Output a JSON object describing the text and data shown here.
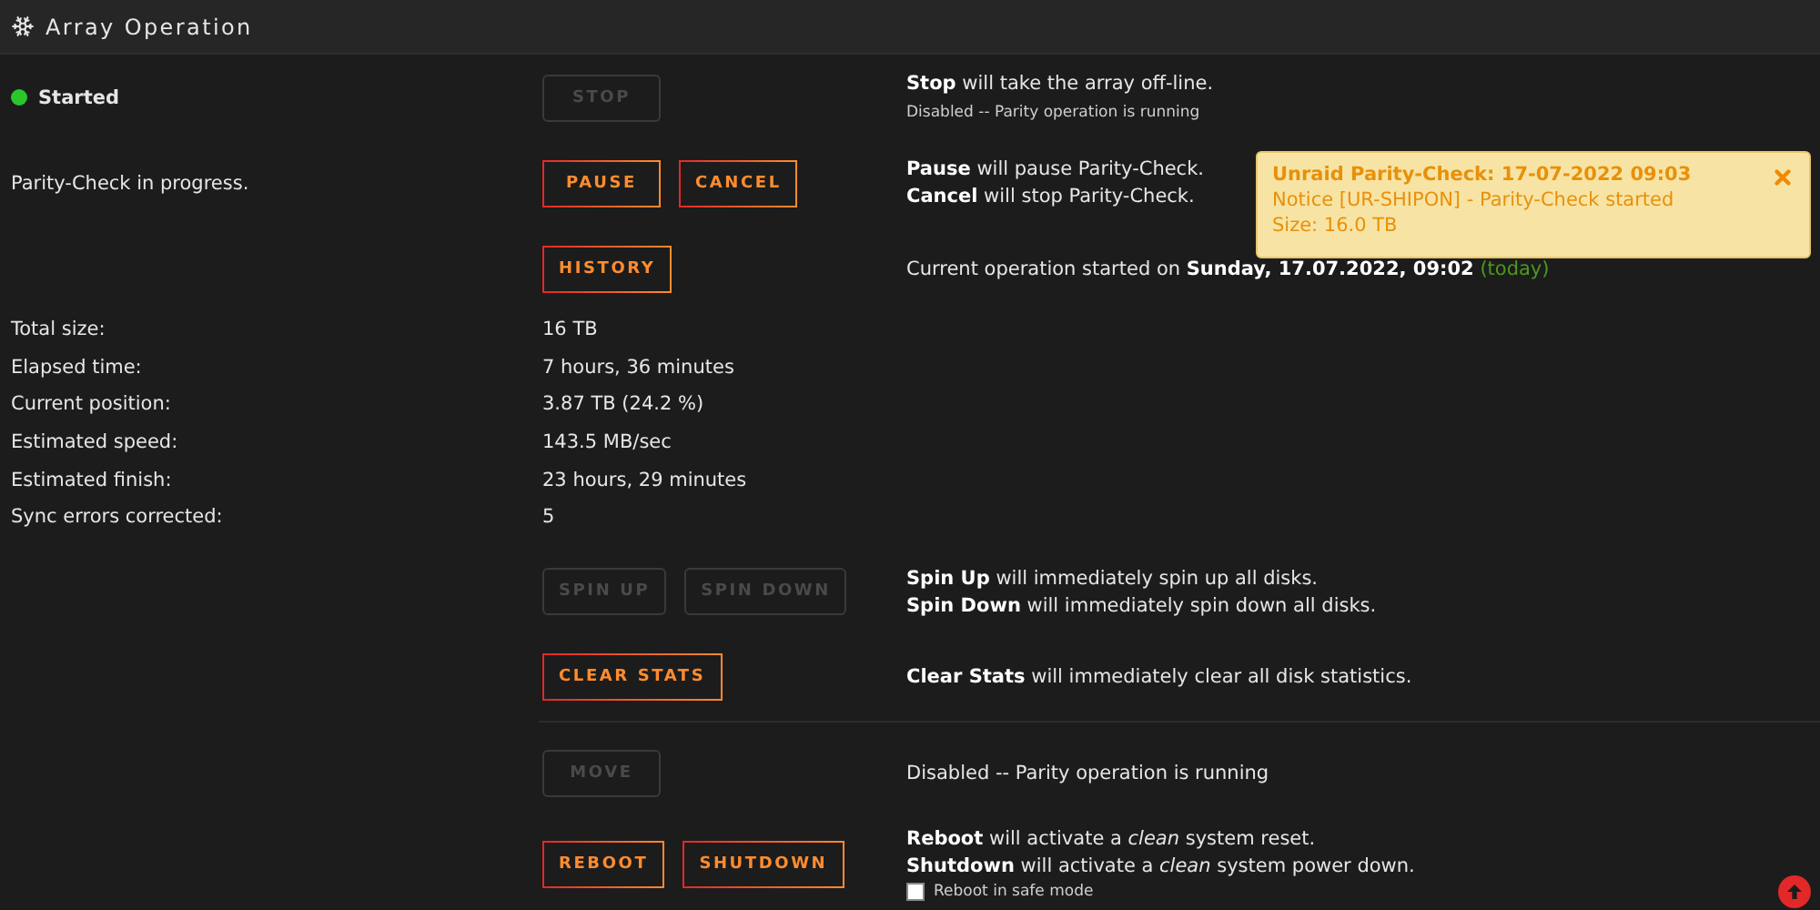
{
  "header": {
    "title": "Array Operation"
  },
  "operations": [
    {
      "left": {
        "text": "Started",
        "kind": "status",
        "on": true
      },
      "buttons": [
        {
          "label": "STOP",
          "disabled": true
        }
      ],
      "lines": [
        {
          "text": "**Stop** will take the array off-line."
        },
        {
          "text": "Disabled -- Parity operation is running",
          "kind": "note"
        }
      ]
    },
    {
      "left": {
        "text": "Parity-Check in progress.",
        "kind": "plain"
      },
      "buttons": [
        {
          "label": "PAUSE",
          "disabled": false
        },
        {
          "label": "CANCEL",
          "disabled": false
        }
      ],
      "lines": [
        {
          "text": "**Pause** will pause Parity-Check."
        },
        {
          "text": "**Cancel** will stop Parity-Check."
        }
      ]
    },
    {
      "buttons": [
        {
          "label": "HISTORY",
          "disabled": false
        }
      ],
      "lines": [
        {
          "text": "Current operation started on **Sunday, 17.07.2022, 09:02**",
          "tag": "(today)"
        }
      ]
    }
  ],
  "stats": [
    {
      "label": "Total size:",
      "value": "16 TB"
    },
    {
      "label": "Elapsed time:",
      "value": "7 hours, 36 minutes"
    },
    {
      "label": "Current position:",
      "value": "3.87 TB (24.2 %)"
    },
    {
      "label": "Estimated speed:",
      "value": "143.5 MB/sec"
    },
    {
      "label": "Estimated finish:",
      "value": "23 hours, 29 minutes"
    },
    {
      "label": "Sync errors corrected:",
      "value": "5"
    }
  ],
  "disk_operations": [
    {
      "buttons": [
        {
          "label": "SPIN UP",
          "disabled": true
        },
        {
          "label": "SPIN DOWN",
          "disabled": true
        }
      ],
      "lines": [
        {
          "text": "**Spin Up** will immediately spin up all disks."
        },
        {
          "text": "**Spin Down** will immediately spin down all disks."
        }
      ]
    },
    {
      "buttons": [
        {
          "label": "CLEAR STATS",
          "disabled": false
        }
      ],
      "lines": [
        {
          "text": "**Clear Stats** will immediately clear all disk statistics."
        }
      ]
    }
  ],
  "power_operations": [
    {
      "buttons": [
        {
          "label": "MOVE",
          "disabled": true
        }
      ],
      "lines": [
        {
          "text": "Disabled -- Parity operation is running"
        }
      ]
    },
    {
      "buttons": [
        {
          "label": "REBOOT",
          "disabled": false
        },
        {
          "label": "SHUTDOWN",
          "disabled": false
        }
      ],
      "lines": [
        {
          "text": "**Reboot** will activate a *clean* system reset."
        },
        {
          "text": "**Shutdown** will activate a *clean* system power down."
        }
      ],
      "checkbox": {
        "label": "Reboot in safe mode",
        "checked": false
      }
    }
  ],
  "notification": {
    "title": "Unraid Parity-Check: 17-07-2022 09:03",
    "lines": [
      "Notice [UR-SHIPON] - Parity-Check started",
      "Size: 16.0 TB"
    ]
  }
}
